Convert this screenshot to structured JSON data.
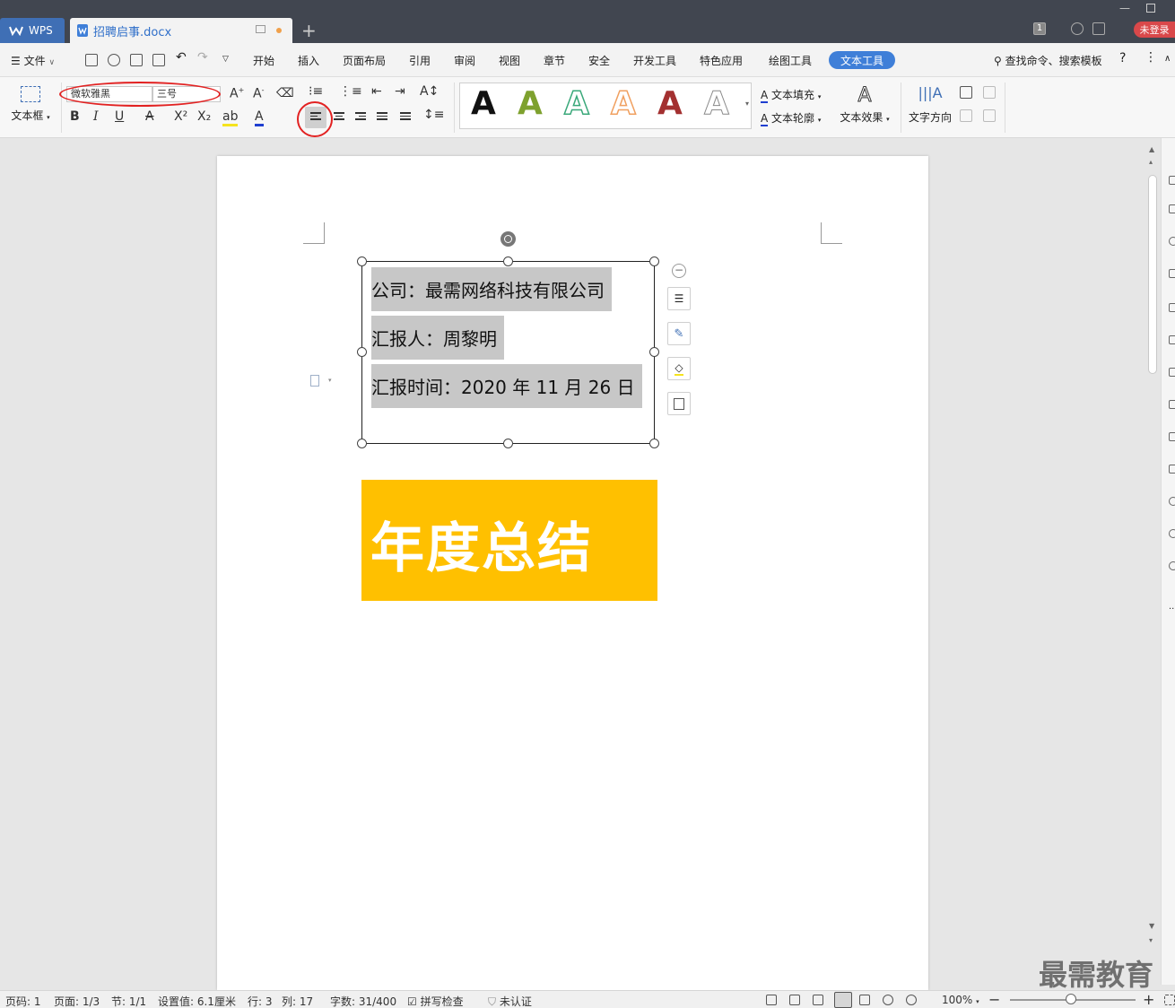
{
  "titlebar": {
    "app_tab": "WPS",
    "doc_tab": "招聘启事.docx",
    "login": "未登录",
    "window_number": "1"
  },
  "menu": {
    "file": "文件",
    "items": [
      "开始",
      "插入",
      "页面布局",
      "引用",
      "审阅",
      "视图",
      "章节",
      "安全",
      "开发工具",
      "特色应用",
      "绘图工具"
    ],
    "active": "文本工具",
    "search": "查找命令、搜索模板",
    "help": "?"
  },
  "ribbon": {
    "textbox_label": "文本框",
    "font_name": "微软雅黑",
    "font_size": "三号",
    "wordart_letter": "A",
    "wordart_colors": [
      "#111111",
      "#7ea12e",
      "#3aa87a",
      "#f0a060",
      "#a33030",
      "#8a8a8a"
    ],
    "text_fill": "文本填充",
    "text_outline": "文本轮廓",
    "text_effect": "文本效果",
    "text_direction": "文字方向",
    "annotation_color": "#e22222"
  },
  "document": {
    "textbox_lines": [
      "公司：最需网络科技有限公司",
      "汇报人：周黎明",
      "汇报时间：2020 年 11 月 26 日"
    ],
    "banner_title": "年度总结",
    "banner_color": "#ffc000"
  },
  "status": {
    "page_code": "页码: 1",
    "pages": "页面: 1/3",
    "section": "节: 1/1",
    "setting": "设置值: 6.1厘米",
    "row": "行: 3",
    "col": "列: 17",
    "word_count": "字数: 31/400",
    "spell_check": "拼写检查",
    "certification": "未认证",
    "zoom": "100%"
  },
  "watermark": "最需教育"
}
